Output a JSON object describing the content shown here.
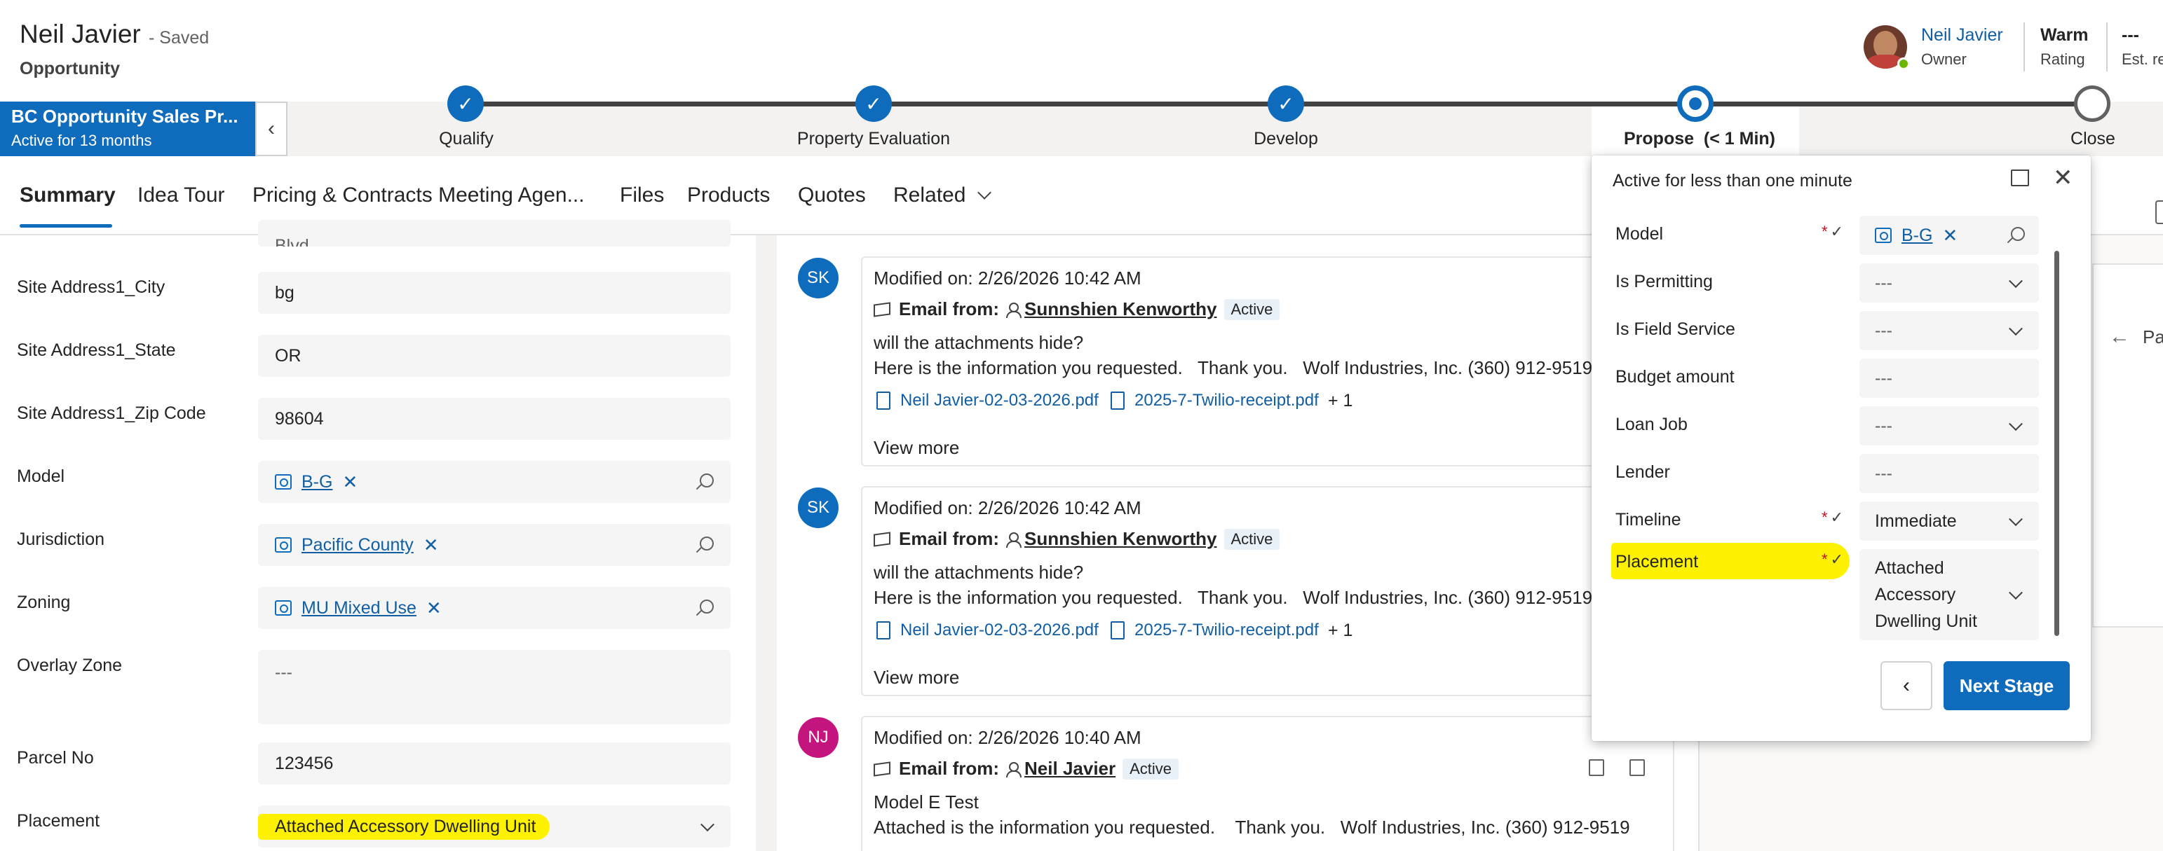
{
  "header": {
    "title": "Neil Javier",
    "saved": "- Saved",
    "entity": "Opportunity",
    "owner_name": "Neil Javier",
    "owner_label": "Owner",
    "rating_value": "Warm",
    "rating_label": "Rating",
    "est_value": "---",
    "est_label": "Est. re"
  },
  "process": {
    "name": "BC Opportunity Sales Pr...",
    "active_for": "Active for 13 months",
    "stages": [
      {
        "label": "Qualify",
        "state": "done"
      },
      {
        "label": "Property Evaluation",
        "state": "done"
      },
      {
        "label": "Develop",
        "state": "done"
      },
      {
        "label": "Propose  (< 1 Min)",
        "state": "active"
      },
      {
        "label": "Close",
        "state": "future"
      }
    ]
  },
  "tabs": [
    "Summary",
    "Idea Tour",
    "Pricing & Contracts Meeting Agen...",
    "Files",
    "Products",
    "Quotes",
    "Related"
  ],
  "form": {
    "partial_top": "Blvd",
    "fields": [
      {
        "label": "Site Address1_City",
        "value": "bg"
      },
      {
        "label": "Site Address1_State",
        "value": "OR"
      },
      {
        "label": "Site Address1_Zip Code",
        "value": "98604"
      },
      {
        "label": "Model",
        "value": "B-G"
      },
      {
        "label": "Jurisdiction",
        "value": "Pacific County"
      },
      {
        "label": "Zoning",
        "value": "MU Mixed Use"
      },
      {
        "label": "Overlay Zone",
        "value": "---"
      },
      {
        "label": "Parcel No",
        "value": "123456"
      },
      {
        "label": "Placement",
        "value": "Attached Accessory Dwelling Unit"
      }
    ]
  },
  "timeline": [
    {
      "initials": "SK",
      "avatar_color": "#0f6cbd",
      "modified": "Modified on: 2/26/2026 10:42 AM",
      "from_label": "Email from:",
      "from_name": "Sunnshien Kenworthy",
      "status": "Active",
      "line1": "will the attachments hide?",
      "line2": "Here is the information you requested.   Thank you.   Wolf Industries, Inc. (360) 912-9519",
      "att1": "Neil Javier-02-03-2026.pdf",
      "att2": "2025-7-Twilio-receipt.pdf",
      "more": "+ 1",
      "view_more": "View more"
    },
    {
      "initials": "SK",
      "avatar_color": "#0f6cbd",
      "modified": "Modified on: 2/26/2026 10:42 AM",
      "from_label": "Email from:",
      "from_name": "Sunnshien Kenworthy",
      "status": "Active",
      "line1": "will the attachments hide?",
      "line2": "Here is the information you requested.   Thank you.   Wolf Industries, Inc. (360) 912-9519",
      "att1": "Neil Javier-02-03-2026.pdf",
      "att2": "2025-7-Twilio-receipt.pdf",
      "more": "+ 1",
      "view_more": "View more"
    },
    {
      "initials": "NJ",
      "avatar_color": "#c4157f",
      "modified": "Modified on: 2/26/2026 10:40 AM",
      "from_label": "Email from:",
      "from_name": "Neil Javier",
      "status": "Active",
      "line1": "Model E Test",
      "line2": "Attached is the information you requested.    Thank you.   Wolf Industries, Inc. (360) 912-9519"
    }
  ],
  "right_panel": {
    "label": "Pa"
  },
  "flyout": {
    "heading": "Active for less than one minute",
    "required_mark": "*",
    "fields": [
      {
        "label": "Model",
        "value": "B-G",
        "required": true
      },
      {
        "label": "Is Permitting",
        "value": "---"
      },
      {
        "label": "Is Field Service",
        "value": "---"
      },
      {
        "label": "Budget amount",
        "value": "---"
      },
      {
        "label": "Loan Job",
        "value": "---"
      },
      {
        "label": "Lender",
        "value": "---"
      },
      {
        "label": "Timeline",
        "value": "Immediate",
        "required": true
      },
      {
        "label": "Placement",
        "value_lines": [
          "Attached",
          "Accessory",
          "Dwelling Unit"
        ],
        "required": true
      }
    ],
    "next_stage": "Next Stage"
  },
  "colors": {
    "accent": "#0f6cbd",
    "highlight": "#fff200",
    "required": "#c50f1f"
  }
}
